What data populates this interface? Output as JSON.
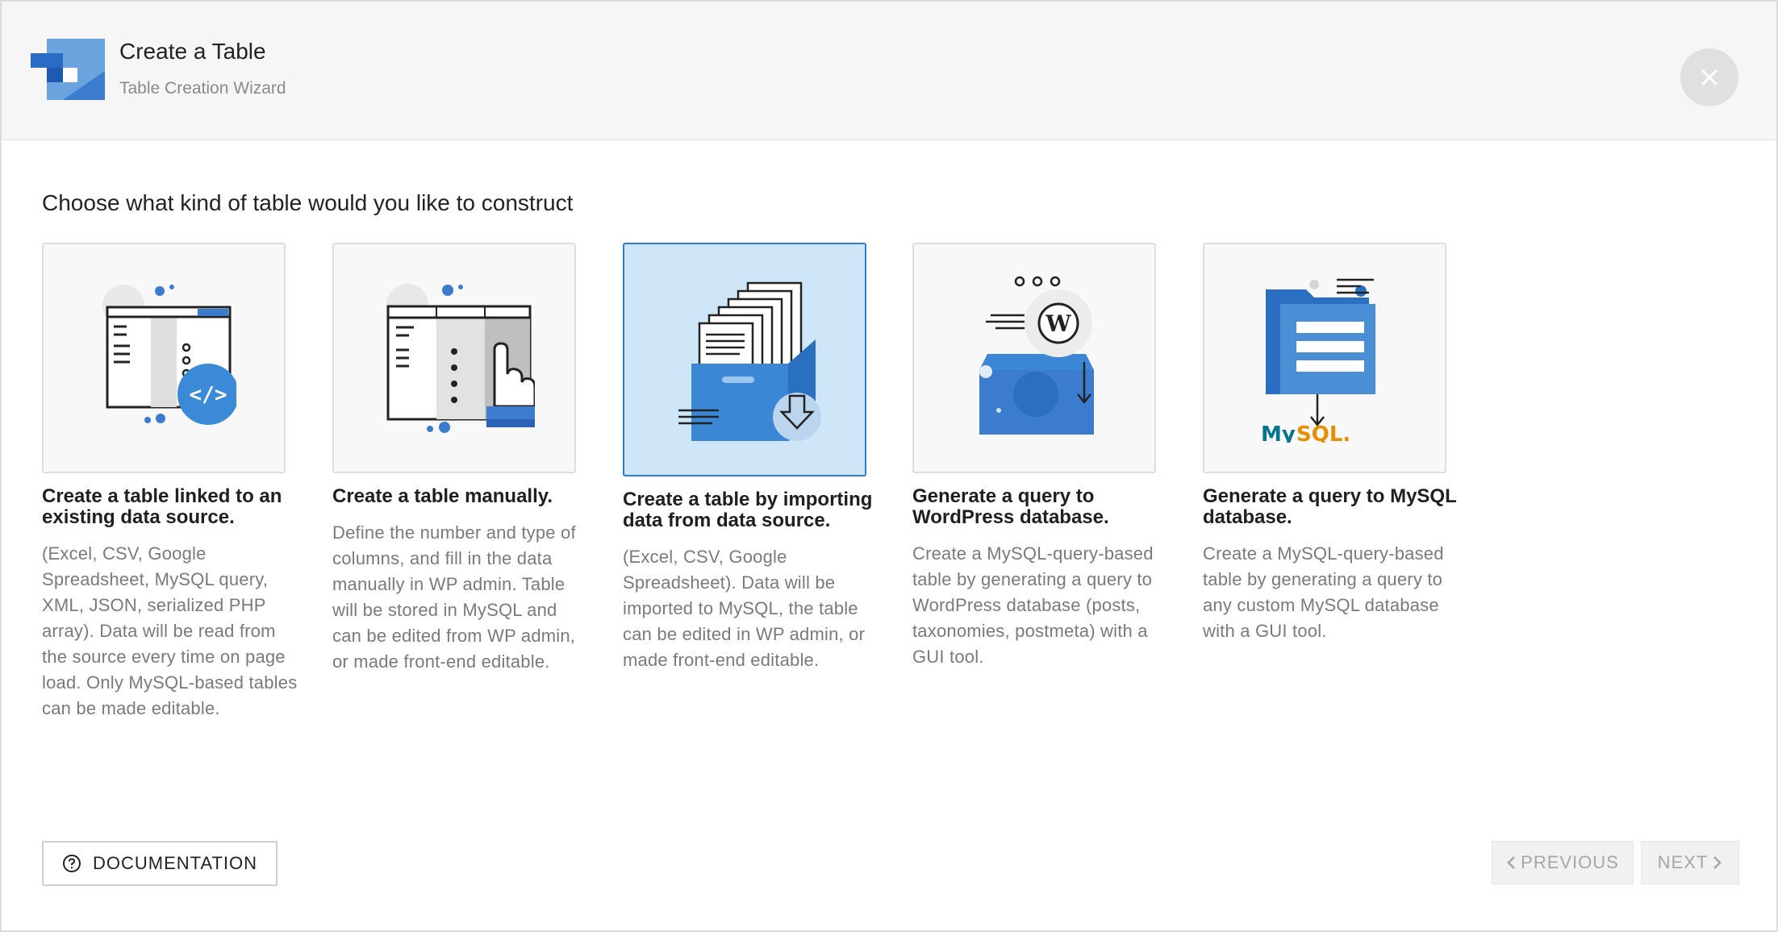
{
  "header": {
    "title": "Create a Table",
    "subtitle": "Table Creation Wizard",
    "close_icon": "close-icon"
  },
  "prompt": "Choose what kind of table would you like to construct",
  "options": [
    {
      "title": "Create a table linked to an existing data source.",
      "description": "(Excel, CSV, Google Spreadsheet, MySQL query, XML, JSON, serialized PHP array). Data will be read from the source every time on page load. Only MySQL-based tables can be made editable.",
      "selected": false,
      "icon": "linked-table-code-icon"
    },
    {
      "title": "Create a table manually.",
      "description": "Define the number and type of columns, and fill in the data manually in WP admin. Table will be stored in MySQL and can be edited from WP admin, or made front-end editable.",
      "selected": false,
      "icon": "manual-table-hand-icon"
    },
    {
      "title": "Create a table by importing data from data source.",
      "description": "(Excel, CSV, Google Spreadsheet). Data will be imported to MySQL, the table can be edited in WP admin, or made front-end editable.",
      "selected": true,
      "icon": "import-files-box-icon"
    },
    {
      "title": "Generate a query to WordPress database.",
      "description": "Create a MySQL-query-based table by generating a query to WordPress database (posts, taxonomies, postmeta) with a GUI tool.",
      "selected": false,
      "icon": "wordpress-query-icon"
    },
    {
      "title": "Generate a query to MySQL database.",
      "description": "Create a MySQL-query-based table by generating a query to any custom MySQL database with a GUI tool.",
      "selected": false,
      "icon": "mysql-query-icon",
      "logo_text": "MySQL."
    }
  ],
  "footer": {
    "documentation_label": "DOCUMENTATION",
    "previous_label": "PREVIOUS",
    "next_label": "NEXT"
  },
  "colors": {
    "accent_blue": "#2a7fd4",
    "selected_bg": "#cfe6f8",
    "illustration_blue": "#4a8fd6",
    "mysql_orange": "#e48e00",
    "mysql_blue": "#00758f"
  }
}
